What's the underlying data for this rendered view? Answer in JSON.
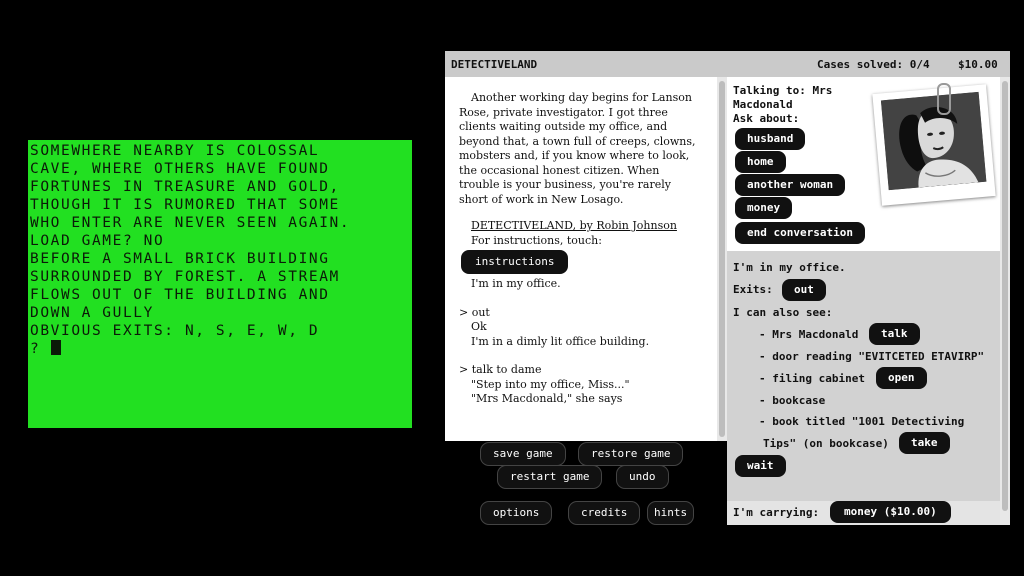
{
  "retro_screen": {
    "lines": [
      "SOMEWHERE NEARBY IS COLOSSAL",
      "CAVE, WHERE OTHERS HAVE FOUND",
      "FORTUNES IN TREASURE AND GOLD,",
      "THOUGH IT IS RUMORED THAT SOME",
      "WHO ENTER ARE NEVER SEEN AGAIN.",
      "LOAD GAME? NO",
      "BEFORE A SMALL BRICK BUILDING",
      "SURROUNDED BY FOREST. A STREAM",
      "FLOWS OUT OF THE BUILDING AND",
      "DOWN A GULLY",
      "OBVIOUS EXITS: N, S, E, W, D",
      "? "
    ]
  },
  "header": {
    "title": "DETECTIVELAND",
    "cases": "Cases solved: 0/4",
    "money": "$10.00"
  },
  "transcript": {
    "intro": "Another working day begins for Lanson Rose, private investigator. I got three clients waiting outside my office, and beyond that, a town full of creeps, clowns, mobsters and, if you know where to look, the occasional honest citizen. When trouble is your business, you're rarely short of work in New Losago.",
    "credit_title": "DETECTIVELAND, by Robin Johnson",
    "instructions_prompt": "For instructions, touch:",
    "instructions_button": "instructions",
    "in_office": "I'm in my office.",
    "cmd1": "> out",
    "ok": "Ok",
    "dimly": "I'm in a dimly lit office building.",
    "cmd2": "> talk to dame",
    "step": "\"Step into my office, Miss...\"",
    "mrs": "\"Mrs Macdonald,\" she says"
  },
  "talk": {
    "talking_to": "Talking to: Mrs Macdonald",
    "ask_about": "Ask about:",
    "topics": [
      "husband",
      "home",
      "another woman",
      "money",
      "end conversation"
    ]
  },
  "room": {
    "location": "I'm in my office.",
    "exits_label": "Exits:",
    "exit_out": "out",
    "also_see": "I can also see:",
    "item1": "- Mrs Macdonald",
    "item1_btn": "talk",
    "item2": "- door reading \"EVITCETED ETAVIRP\"",
    "item3": "- filing cabinet",
    "item3_btn": "open",
    "item4": "- bookcase",
    "item5a": "- book titled \"1001 Detectiving",
    "item5b": "Tips\" (on bookcase)",
    "item5_btn": "take",
    "wait": "wait"
  },
  "carrying": {
    "label": "I'm carrying:",
    "item": "money ($10.00)"
  },
  "buttons": {
    "save": "save game",
    "restore": "restore game",
    "restart": "restart game",
    "undo": "undo",
    "options": "options",
    "credits": "credits",
    "hints": "hints"
  }
}
